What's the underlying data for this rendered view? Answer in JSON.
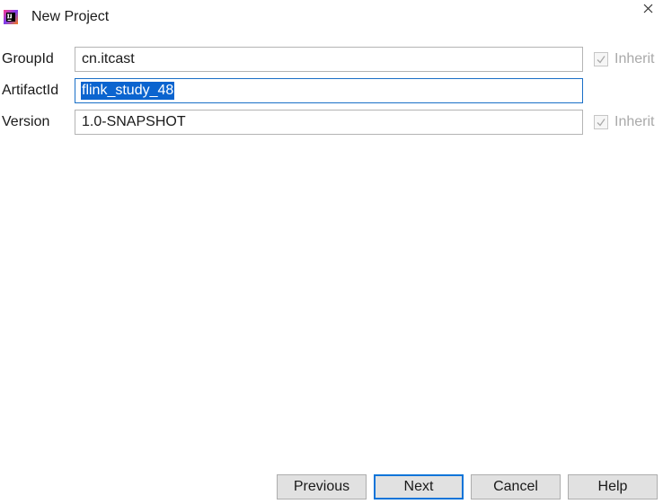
{
  "window": {
    "title": "New Project",
    "icon": "intellij-idea-icon",
    "close_icon": "close-icon"
  },
  "form": {
    "group_id": {
      "label": "GroupId",
      "value": "cn.itcast",
      "inherit_label": "Inherit",
      "inherit_checked": true,
      "inherit_enabled": false
    },
    "artifact_id": {
      "label": "ArtifactId",
      "value": "flink_study_48",
      "selected": true
    },
    "version": {
      "label": "Version",
      "value": "1.0-SNAPSHOT",
      "inherit_label": "Inherit",
      "inherit_checked": true,
      "inherit_enabled": false
    }
  },
  "buttons": {
    "previous": "Previous",
    "next": "Next",
    "cancel": "Cancel",
    "help": "Help"
  },
  "colors": {
    "selection": "#0b64cf",
    "focus_border": "#1a6fc7",
    "default_button_border": "#0a74d9",
    "disabled_text": "#a9a9a9"
  }
}
